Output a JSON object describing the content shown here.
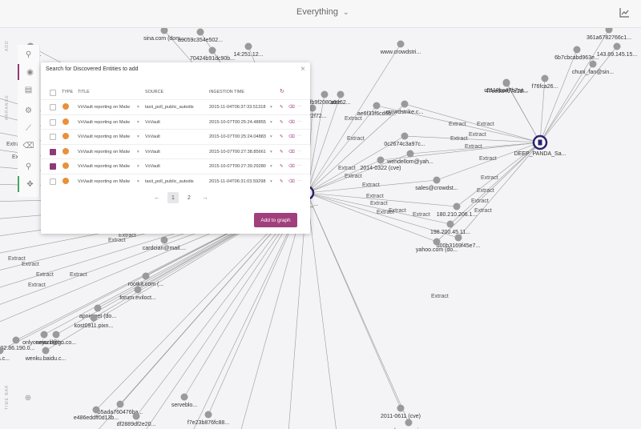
{
  "header": {
    "view_label": "Everything",
    "chevron_icon": "chevron-down-icon",
    "chart_icon": "chart-icon"
  },
  "toolbar": {
    "items": [
      {
        "icon": "search-icon"
      },
      {
        "icon": "eye-icon"
      },
      {
        "icon": "folder-icon"
      },
      {
        "icon": "arrange-icon"
      },
      {
        "icon": "line-icon"
      },
      {
        "icon": "trash-icon"
      },
      {
        "icon": "zoom-icon"
      },
      {
        "icon": "move-icon"
      }
    ],
    "side_labels": {
      "add": "ADD",
      "arrange": "ARRANGE",
      "time_bar": "TIME BAR"
    }
  },
  "panel": {
    "title": "Search for Discovered Entities to add",
    "columns": {
      "type": "TYPE",
      "title": "TITLE",
      "source": "SOURCE",
      "ingestion": "INGESTION TIME"
    },
    "rows": [
      {
        "checked": false,
        "title": "VxVault reporting on Malw",
        "source": "taxii_poll_public_autodis",
        "time": "2015-11-04T06:37:33.51318"
      },
      {
        "checked": false,
        "title": "VxVault reporting on Malw",
        "source": "VxVault",
        "time": "2015-10-07T00:25:24.48855"
      },
      {
        "checked": false,
        "title": "VxVault reporting on Malw",
        "source": "VxVault",
        "time": "2015-10-07T00:25:24.04883"
      },
      {
        "checked": true,
        "title": "VxVault reporting on Malw",
        "source": "VxVault",
        "time": "2015-10-07T00:27:38.85661"
      },
      {
        "checked": true,
        "title": "VxVault reporting on Malw",
        "source": "VxVault",
        "time": "2015-10-07T00:27:39.29280"
      },
      {
        "checked": false,
        "title": "VxVault reporting on Malw",
        "source": "taxii_poll_public_autodis",
        "time": "2015-11-04T06:31:03.59298"
      }
    ],
    "pager": {
      "prev": "←",
      "pages": [
        "1",
        "2"
      ],
      "next": "→"
    },
    "add_button": "Add to graph"
  },
  "graph": {
    "center_label": "DEEP_PANDA_Sa...",
    "hub_label": "report_...",
    "edge_label": "Extract",
    "node_labels": [
      "sina.com (dom...",
      "a9059c354e502...",
      "70424b91dc90b...",
      "14:251.12...",
      "www.crowdstri...",
      "361a6782766c1...",
      "143.89.145.15...",
      "6b7cbcabd963e...",
      "chuni_fan@sin...",
      "47ee9a497a1d...",
      "f76fca26...",
      "c5118ba47b7aa...",
      "a5162...",
      "bbfb9f2080aee...",
      "dde22f72...",
      "ae6f33f6cd6b...",
      "crowdstrike.c...",
      "0c2674c3a97c...",
      "wendellom@yah...",
      "2014-0322 (cve)",
      "sales@crowdst...",
      "180.210.206.1...",
      "198.200.45.11...",
      "d00b3169f45e7...",
      "yahoo.com (do...",
      "cardcian@mail....",
      "rootkit.com (...",
      "forum.eviloct...",
      "apnic.net (do...",
      "kost0911.pixn...",
      "onlyonejazz@h...",
      "www.likego.co...",
      "202.86.190.0...",
      "sina.c...",
      "wenku.baidu.c...",
      "b5ada760476ba...",
      "e486eddff0d13b...",
      "f7e23b876fc88...",
      "serveblo...",
      "df2889df2e20...",
      "2011-0611 (cve)",
      "nahoonservice...",
      "3b8e3f..."
    ]
  }
}
